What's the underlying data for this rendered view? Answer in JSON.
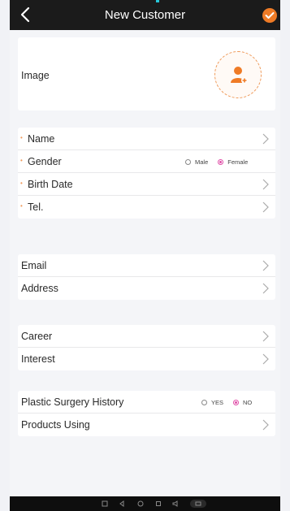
{
  "header": {
    "title": "New Customer"
  },
  "image_card": {
    "label": "Image"
  },
  "required_card": {
    "name_label": "Name",
    "gender_label": "Gender",
    "gender_options": [
      "Male",
      "Female"
    ],
    "gender_selected": "Female",
    "birth_label": "Birth Date",
    "tel_label": "Tel."
  },
  "contact_card": {
    "email_label": "Email",
    "address_label": "Address"
  },
  "profile_card": {
    "career_label": "Career",
    "interest_label": "Interest"
  },
  "history_card": {
    "surgery_label": "Plastic Surgery History",
    "surgery_options": [
      "YES",
      "NO"
    ],
    "surgery_selected": "NO",
    "products_label": "Products Using"
  },
  "colors": {
    "accent": "#ef7b26",
    "radio_selected": "#e04fa8",
    "header_bg": "#1b1b1b"
  }
}
